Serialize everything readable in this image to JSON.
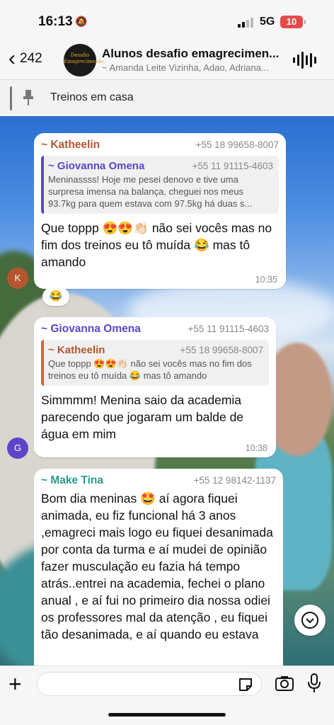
{
  "status_bar": {
    "time": "16:13",
    "network": "5G",
    "battery": "10"
  },
  "header": {
    "back_count": "242",
    "avatar_text": "Desafio Emagrecimento",
    "title": "Alunos desafio emagrecimen...",
    "subtitle": "~ Amanda Leite Vizinha, Adao, Adriana..."
  },
  "pinned": {
    "text": "Treinos em casa"
  },
  "messages": [
    {
      "sender": "~ Katheelin",
      "phone": "+55 18 99658-8007",
      "quote": {
        "sender": "~ Giovanna Omena",
        "phone": "+55 11 91115-4603",
        "text": "Meninassss! Hoje me pesei denovo e tive uma surpresa imensa na balança, cheguei nos meus 93.7kg para quem estava com 97.5kg há duas s..."
      },
      "text": "Que toppp 😍😍👏🏻 não sei vocês mas no fim dos treinos eu tô muída 😂 mas tô amando",
      "time": "10:35",
      "avatar": "K",
      "reaction": "😂"
    },
    {
      "sender": "~ Giovanna Omena",
      "phone": "+55 11 91115-4603",
      "quote": {
        "sender": "~ Katheelin",
        "phone": "+55 18 99658-8007",
        "text": "Que toppp 😍😍👏🏻 não sei vocês mas no fim dos treinos eu tô muída 😂 mas tô amando"
      },
      "text": "Simmmm! Menina saio da academia parecendo que jogaram um balde de água em mim",
      "time": "10:38",
      "avatar": "G"
    },
    {
      "sender": "~ Make Tina",
      "phone": "+55 12 98142-1137",
      "text": "Bom dia meninas 🤩 aí agora fiquei animada, eu fiz funcional há 3 anos ,emagreci mais logo eu fiquei desanimada por conta da turma e aí mudei de opinião fazer musculação eu fazia há tempo atrás..entrei na academia, fechei o plano anual , e aí fui no primeiro dia nossa odiei os professores mal da atenção , eu fiquei tão desanimada, e aí quando eu estava"
    }
  ],
  "colors": {
    "katheelin": "#b5562f",
    "giovanna": "#5b46c9",
    "make_tina": "#2a9a8c",
    "avatar_k": "#b5562f",
    "avatar_g": "#5b46c9"
  }
}
